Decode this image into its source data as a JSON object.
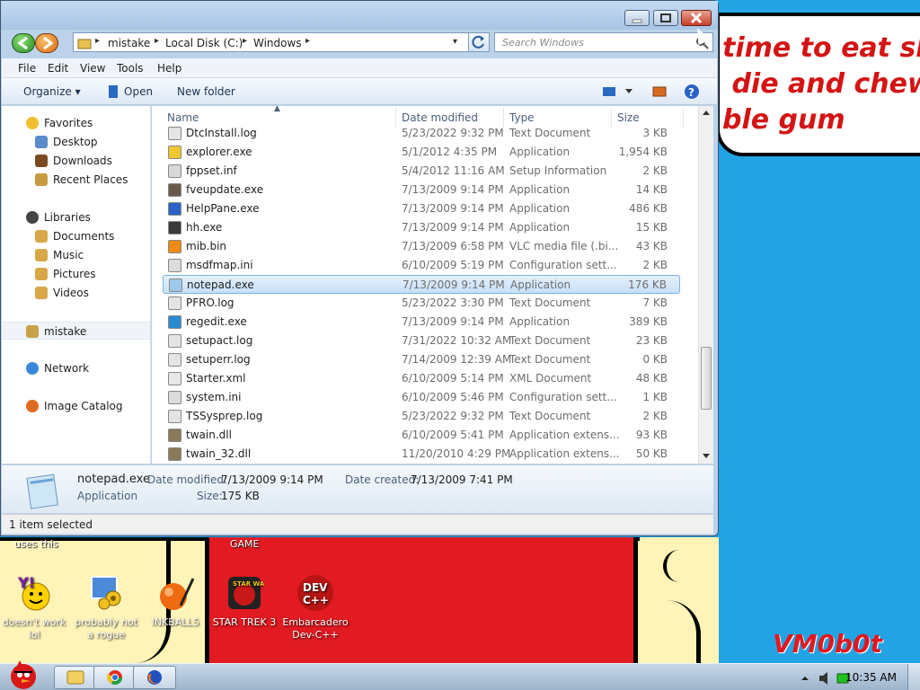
{
  "wallpaper": {
    "banner_text": "time to eat shit\n die and chew\nble gum",
    "label_left": "uses this",
    "label_game": "GAME",
    "signature": "VM0b0t",
    "colors": {
      "sky": "#22a4e4",
      "red": "#e21a22",
      "cream": "#fff4b8"
    }
  },
  "desktop_icons": [
    {
      "label": "doesn't work lol",
      "icon": "yahoo-messenger-icon"
    },
    {
      "label": "probably not a rogue",
      "icon": "computer-gears-icon"
    },
    {
      "label": "INKBALLS",
      "icon": "inkball-icon"
    },
    {
      "label": "STAR TREK 3",
      "icon": "star-wars-angry-birds-icon"
    },
    {
      "label": "Embarcadero Dev-C++",
      "icon": "dev-cpp-icon"
    }
  ],
  "taskbar": {
    "clock": "10:35 AM",
    "buttons": [
      "explorer-icon",
      "chrome-icon",
      "firefox-icon"
    ]
  },
  "window": {
    "address": {
      "crumbs": [
        "mistake",
        "Local Disk (C:)",
        "Windows"
      ]
    },
    "search": {
      "placeholder": "Search Windows"
    },
    "menu": [
      "File",
      "Edit",
      "View",
      "Tools",
      "Help"
    ],
    "toolbar": {
      "organize": "Organize",
      "open": "Open",
      "new_folder": "New folder"
    },
    "nav": {
      "favorites": "Favorites",
      "fav_items": [
        "Desktop",
        "Downloads",
        "Recent Places"
      ],
      "libraries": "Libraries",
      "lib_items": [
        "Documents",
        "Music",
        "Pictures",
        "Videos"
      ],
      "homegroup": "mistake",
      "network": "Network",
      "catalog": "Image Catalog"
    },
    "columns": {
      "name": "Name",
      "date": "Date modified",
      "type": "Type",
      "size": "Size"
    },
    "files": [
      {
        "name": "DtcInstall.log",
        "date": "5/23/2022 9:32 PM",
        "type": "Text Document",
        "size": "3 KB",
        "icon": "text-file-icon"
      },
      {
        "name": "explorer.exe",
        "date": "5/1/2012 4:35 PM",
        "type": "Application",
        "size": "1,954 KB",
        "icon": "explorer-icon"
      },
      {
        "name": "fppset.inf",
        "date": "5/4/2012 11:16 AM",
        "type": "Setup Information",
        "size": "2 KB",
        "icon": "setup-file-icon"
      },
      {
        "name": "fveupdate.exe",
        "date": "7/13/2009 9:14 PM",
        "type": "Application",
        "size": "14 KB",
        "icon": "application-icon"
      },
      {
        "name": "HelpPane.exe",
        "date": "7/13/2009 9:14 PM",
        "type": "Application",
        "size": "486 KB",
        "icon": "help-icon"
      },
      {
        "name": "hh.exe",
        "date": "7/13/2009 9:14 PM",
        "type": "Application",
        "size": "15 KB",
        "icon": "help-book-icon"
      },
      {
        "name": "mib.bin",
        "date": "7/13/2009 6:58 PM",
        "type": "VLC media file (.bi...",
        "size": "43 KB",
        "icon": "vlc-icon"
      },
      {
        "name": "msdfmap.ini",
        "date": "6/10/2009 5:19 PM",
        "type": "Configuration sett...",
        "size": "2 KB",
        "icon": "config-file-icon"
      },
      {
        "name": "notepad.exe",
        "date": "7/13/2009 9:14 PM",
        "type": "Application",
        "size": "176 KB",
        "icon": "notepad-icon"
      },
      {
        "name": "PFRO.log",
        "date": "5/23/2022 3:30 PM",
        "type": "Text Document",
        "size": "7 KB",
        "icon": "text-file-icon"
      },
      {
        "name": "regedit.exe",
        "date": "7/13/2009 9:14 PM",
        "type": "Application",
        "size": "389 KB",
        "icon": "regedit-icon"
      },
      {
        "name": "setupact.log",
        "date": "7/31/2022 10:32 AM",
        "type": "Text Document",
        "size": "23 KB",
        "icon": "text-file-icon"
      },
      {
        "name": "setuperr.log",
        "date": "7/14/2009 12:39 AM",
        "type": "Text Document",
        "size": "0 KB",
        "icon": "text-file-icon"
      },
      {
        "name": "Starter.xml",
        "date": "6/10/2009 5:14 PM",
        "type": "XML Document",
        "size": "48 KB",
        "icon": "xml-file-icon"
      },
      {
        "name": "system.ini",
        "date": "6/10/2009 5:46 PM",
        "type": "Configuration sett...",
        "size": "1 KB",
        "icon": "config-file-icon"
      },
      {
        "name": "TSSysprep.log",
        "date": "5/23/2022 9:32 PM",
        "type": "Text Document",
        "size": "2 KB",
        "icon": "text-file-icon"
      },
      {
        "name": "twain.dll",
        "date": "6/10/2009 5:41 PM",
        "type": "Application extens...",
        "size": "93 KB",
        "icon": "dll-icon"
      },
      {
        "name": "twain_32.dll",
        "date": "11/20/2010 4:29 PM",
        "type": "Application extens...",
        "size": "50 KB",
        "icon": "dll-icon"
      }
    ],
    "selected_index": 8,
    "details": {
      "name": "notepad.exe",
      "type": "Application",
      "modified_label": "Date modified:",
      "modified": "7/13/2009 9:14 PM",
      "created_label": "Date created:",
      "created": "7/13/2009 7:41 PM",
      "size_label": "Size:",
      "size": "175 KB"
    },
    "status": "1 item selected"
  }
}
